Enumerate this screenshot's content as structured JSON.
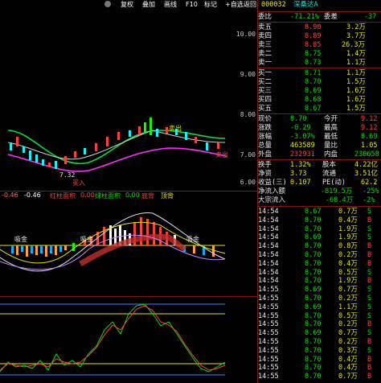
{
  "toolbar": {
    "items": [
      "复权",
      "叠加",
      "画线",
      "F10",
      "标记",
      "+自选",
      "返回"
    ]
  },
  "stock": {
    "code": "000032",
    "name": "深桑达A"
  },
  "chart_scale": {
    "price_labels": [
      "10.00",
      "9.00",
      "8.00",
      "7.00",
      "6.00"
    ]
  },
  "annotations": {
    "low_label": "7.32",
    "buy_label": "买入",
    "sell_label": "卖出",
    "sell_label2": "卖出",
    "low_marker": "低",
    "tag_left": "吸金",
    "tag_mid": "吸金",
    "tag_right": "吸金"
  },
  "indicator": {
    "v1": "-0.46",
    "v2": "-0.46",
    "label_a": "红柱面积",
    "val_a": "0.00",
    "label_b": "绿柱面积",
    "val_b": "0.00",
    "label_c": "底背",
    "label_d": "顶背"
  },
  "panel": {
    "weibi": {
      "label": "委比",
      "value": "-71.21%",
      "label2": "委差",
      "value2": "-37"
    },
    "asks": [
      {
        "label": "卖五",
        "price": "8.90",
        "vol": "3.2万"
      },
      {
        "label": "卖四",
        "price": "8.89",
        "vol": "3.7万"
      },
      {
        "label": "卖三",
        "price": "8.85",
        "vol": "26.3万"
      },
      {
        "label": "卖二",
        "price": "8.75",
        "vol": "1.4万"
      },
      {
        "label": "卖一",
        "price": "8.73",
        "vol": "1.1万"
      }
    ],
    "bids": [
      {
        "label": "买一",
        "price": "8.71",
        "vol": "1.1万"
      },
      {
        "label": "买二",
        "price": "8.70",
        "vol": "1.5万"
      },
      {
        "label": "买三",
        "price": "8.69",
        "vol": "1.6万"
      },
      {
        "label": "买四",
        "price": "8.68",
        "vol": "1.6万"
      },
      {
        "label": "买五",
        "price": "8.67",
        "vol": "1.5万"
      }
    ],
    "stats": [
      {
        "l1": "现价",
        "v1": "8.70",
        "l2": "今开",
        "v2": "9.12"
      },
      {
        "l1": "涨跌",
        "v1": "-0.29",
        "l2": "最高",
        "v2": "9.12"
      },
      {
        "l1": "涨幅",
        "v1": "-3.07%",
        "l2": "最低",
        "v2": "8.69"
      },
      {
        "l1": "总量",
        "v1": "463589",
        "l2": "量比",
        "v2": "1.05"
      },
      {
        "l1": "外盘",
        "v1": "232931",
        "l2": "内盘",
        "v2": "230658"
      }
    ],
    "stats2": [
      {
        "l1": "换手",
        "v1": "1.32%",
        "l2": "股本",
        "v2": "4.22亿"
      },
      {
        "l1": "净资",
        "v1": "3.73",
        "l2": "流通",
        "v2": "3.51亿"
      },
      {
        "l1": "收益(三)",
        "v1": "0.107",
        "l2": "PE(动)",
        "v2": "62.2"
      }
    ],
    "flows": [
      {
        "label": "净流入额",
        "value": "-819.5万",
        "pct": "-25%"
      },
      {
        "label": "大宗流入",
        "value": "-68.4万",
        "pct": "-2%"
      }
    ],
    "ticks": [
      {
        "time": "14:54",
        "price": "8.67",
        "vol": "0.7万",
        "dir": "S"
      },
      {
        "time": "14:54",
        "price": "8.70",
        "vol": "0.4万",
        "dir": "B"
      },
      {
        "time": "14:54",
        "price": "8.70",
        "vol": "1.9万",
        "dir": "S"
      },
      {
        "time": "14:54",
        "price": "8.69",
        "vol": "1.9万",
        "dir": "S"
      },
      {
        "time": "14:54",
        "price": "8.70",
        "vol": "0.8万",
        "dir": "B"
      },
      {
        "time": "14:54",
        "price": "8.70",
        "vol": "0.2万",
        "dir": "B"
      },
      {
        "time": "14:54",
        "price": "8.70",
        "vol": "0.4万",
        "dir": "B"
      },
      {
        "time": "14:54",
        "price": "8.70",
        "vol": "0.5万",
        "dir": "S"
      },
      {
        "time": "14:54",
        "price": "8.70",
        "vol": "1.9万",
        "dir": "B"
      },
      {
        "time": "14:55",
        "price": "8.69",
        "vol": "0.7万",
        "dir": "S"
      },
      {
        "time": "14:55",
        "price": "8.70",
        "vol": "0.2万",
        "dir": "S"
      },
      {
        "time": "14:55",
        "price": "8.69",
        "vol": "1.1万",
        "dir": "S"
      },
      {
        "time": "14:55",
        "price": "8.70",
        "vol": "0.5万",
        "dir": "S"
      },
      {
        "time": "14:55",
        "price": "8.70",
        "vol": "0.2万",
        "dir": "B"
      },
      {
        "time": "14:55",
        "price": "8.69",
        "vol": "0.7万",
        "dir": "S"
      },
      {
        "time": "14:55",
        "price": "8.70",
        "vol": "0.2万",
        "dir": "B"
      },
      {
        "time": "14:55",
        "price": "8.70",
        "vol": "0.3万",
        "dir": "S"
      },
      {
        "time": "14:55",
        "price": "8.70",
        "vol": "0.4万",
        "dir": "B"
      },
      {
        "time": "14:55",
        "price": "8.70",
        "vol": "0.4万",
        "dir": "B"
      },
      {
        "time": "14:55",
        "price": "8.70",
        "vol": "0.7万",
        "dir": "B"
      }
    ]
  }
}
